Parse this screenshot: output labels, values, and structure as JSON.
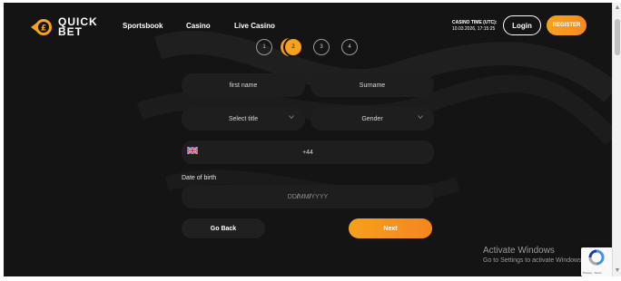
{
  "brand": {
    "logo_line1": "QUICK",
    "logo_line2": "BET",
    "accent": "#f6a21c",
    "background": "#141414"
  },
  "nav": {
    "sportsbook": "Sportsbook",
    "casino": "Casino",
    "live_casino": "Live Casino"
  },
  "header": {
    "casino_time_label": "CASINO TIME (UTC):",
    "casino_time_value": "10.03.2026, 17:15:25",
    "login_label": "Login",
    "register_label": "REGISTER"
  },
  "stepper": {
    "steps": [
      "1",
      "2",
      "3",
      "4"
    ],
    "current_step": 2
  },
  "form": {
    "first_name_placeholder": "first name",
    "surname_placeholder": "Surname",
    "title_placeholder": "Select title",
    "gender_placeholder": "Gender",
    "phone_prefix": "+44",
    "dob_label": "Date of birth",
    "dob_dd": "DD",
    "dob_mm": "MM",
    "dob_yyyy": "YYYY",
    "dob_sep": "/",
    "go_back_label": "Go Back",
    "next_label": "Next"
  },
  "overlay": {
    "activate_title": "Activate Windows",
    "activate_subtitle": "Go to Settings to activate Windows.",
    "recaptcha_links": "Privacy - Terms"
  }
}
